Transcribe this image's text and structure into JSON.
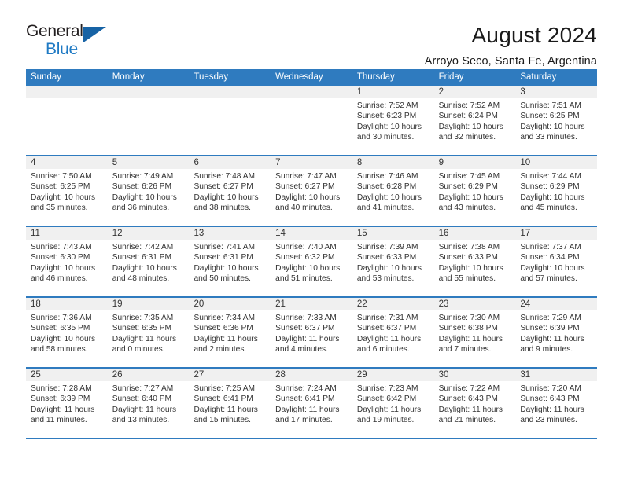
{
  "logo": {
    "text_primary": "General",
    "text_secondary": "Blue",
    "triangle_color": "#1763a5",
    "secondary_color": "#1f7ac4"
  },
  "header": {
    "title": "August 2024",
    "subtitle": "Arroyo Seco, Santa Fe, Argentina"
  },
  "theme": {
    "header_bar": "#2f7bbf",
    "date_band": "#f0f0f0",
    "text": "#333333"
  },
  "weekdays": [
    "Sunday",
    "Monday",
    "Tuesday",
    "Wednesday",
    "Thursday",
    "Friday",
    "Saturday"
  ],
  "weeks": [
    [
      {
        "day": "",
        "empty": true,
        "sunrise": "",
        "sunset": "",
        "daylight1": "",
        "daylight2": ""
      },
      {
        "day": "",
        "empty": true,
        "sunrise": "",
        "sunset": "",
        "daylight1": "",
        "daylight2": ""
      },
      {
        "day": "",
        "empty": true,
        "sunrise": "",
        "sunset": "",
        "daylight1": "",
        "daylight2": ""
      },
      {
        "day": "",
        "empty": true,
        "sunrise": "",
        "sunset": "",
        "daylight1": "",
        "daylight2": ""
      },
      {
        "day": "1",
        "empty": false,
        "sunrise": "Sunrise: 7:52 AM",
        "sunset": "Sunset: 6:23 PM",
        "daylight1": "Daylight: 10 hours",
        "daylight2": "and 30 minutes."
      },
      {
        "day": "2",
        "empty": false,
        "sunrise": "Sunrise: 7:52 AM",
        "sunset": "Sunset: 6:24 PM",
        "daylight1": "Daylight: 10 hours",
        "daylight2": "and 32 minutes."
      },
      {
        "day": "3",
        "empty": false,
        "sunrise": "Sunrise: 7:51 AM",
        "sunset": "Sunset: 6:25 PM",
        "daylight1": "Daylight: 10 hours",
        "daylight2": "and 33 minutes."
      }
    ],
    [
      {
        "day": "4",
        "empty": false,
        "sunrise": "Sunrise: 7:50 AM",
        "sunset": "Sunset: 6:25 PM",
        "daylight1": "Daylight: 10 hours",
        "daylight2": "and 35 minutes."
      },
      {
        "day": "5",
        "empty": false,
        "sunrise": "Sunrise: 7:49 AM",
        "sunset": "Sunset: 6:26 PM",
        "daylight1": "Daylight: 10 hours",
        "daylight2": "and 36 minutes."
      },
      {
        "day": "6",
        "empty": false,
        "sunrise": "Sunrise: 7:48 AM",
        "sunset": "Sunset: 6:27 PM",
        "daylight1": "Daylight: 10 hours",
        "daylight2": "and 38 minutes."
      },
      {
        "day": "7",
        "empty": false,
        "sunrise": "Sunrise: 7:47 AM",
        "sunset": "Sunset: 6:27 PM",
        "daylight1": "Daylight: 10 hours",
        "daylight2": "and 40 minutes."
      },
      {
        "day": "8",
        "empty": false,
        "sunrise": "Sunrise: 7:46 AM",
        "sunset": "Sunset: 6:28 PM",
        "daylight1": "Daylight: 10 hours",
        "daylight2": "and 41 minutes."
      },
      {
        "day": "9",
        "empty": false,
        "sunrise": "Sunrise: 7:45 AM",
        "sunset": "Sunset: 6:29 PM",
        "daylight1": "Daylight: 10 hours",
        "daylight2": "and 43 minutes."
      },
      {
        "day": "10",
        "empty": false,
        "sunrise": "Sunrise: 7:44 AM",
        "sunset": "Sunset: 6:29 PM",
        "daylight1": "Daylight: 10 hours",
        "daylight2": "and 45 minutes."
      }
    ],
    [
      {
        "day": "11",
        "empty": false,
        "sunrise": "Sunrise: 7:43 AM",
        "sunset": "Sunset: 6:30 PM",
        "daylight1": "Daylight: 10 hours",
        "daylight2": "and 46 minutes."
      },
      {
        "day": "12",
        "empty": false,
        "sunrise": "Sunrise: 7:42 AM",
        "sunset": "Sunset: 6:31 PM",
        "daylight1": "Daylight: 10 hours",
        "daylight2": "and 48 minutes."
      },
      {
        "day": "13",
        "empty": false,
        "sunrise": "Sunrise: 7:41 AM",
        "sunset": "Sunset: 6:31 PM",
        "daylight1": "Daylight: 10 hours",
        "daylight2": "and 50 minutes."
      },
      {
        "day": "14",
        "empty": false,
        "sunrise": "Sunrise: 7:40 AM",
        "sunset": "Sunset: 6:32 PM",
        "daylight1": "Daylight: 10 hours",
        "daylight2": "and 51 minutes."
      },
      {
        "day": "15",
        "empty": false,
        "sunrise": "Sunrise: 7:39 AM",
        "sunset": "Sunset: 6:33 PM",
        "daylight1": "Daylight: 10 hours",
        "daylight2": "and 53 minutes."
      },
      {
        "day": "16",
        "empty": false,
        "sunrise": "Sunrise: 7:38 AM",
        "sunset": "Sunset: 6:33 PM",
        "daylight1": "Daylight: 10 hours",
        "daylight2": "and 55 minutes."
      },
      {
        "day": "17",
        "empty": false,
        "sunrise": "Sunrise: 7:37 AM",
        "sunset": "Sunset: 6:34 PM",
        "daylight1": "Daylight: 10 hours",
        "daylight2": "and 57 minutes."
      }
    ],
    [
      {
        "day": "18",
        "empty": false,
        "sunrise": "Sunrise: 7:36 AM",
        "sunset": "Sunset: 6:35 PM",
        "daylight1": "Daylight: 10 hours",
        "daylight2": "and 58 minutes."
      },
      {
        "day": "19",
        "empty": false,
        "sunrise": "Sunrise: 7:35 AM",
        "sunset": "Sunset: 6:35 PM",
        "daylight1": "Daylight: 11 hours",
        "daylight2": "and 0 minutes."
      },
      {
        "day": "20",
        "empty": false,
        "sunrise": "Sunrise: 7:34 AM",
        "sunset": "Sunset: 6:36 PM",
        "daylight1": "Daylight: 11 hours",
        "daylight2": "and 2 minutes."
      },
      {
        "day": "21",
        "empty": false,
        "sunrise": "Sunrise: 7:33 AM",
        "sunset": "Sunset: 6:37 PM",
        "daylight1": "Daylight: 11 hours",
        "daylight2": "and 4 minutes."
      },
      {
        "day": "22",
        "empty": false,
        "sunrise": "Sunrise: 7:31 AM",
        "sunset": "Sunset: 6:37 PM",
        "daylight1": "Daylight: 11 hours",
        "daylight2": "and 6 minutes."
      },
      {
        "day": "23",
        "empty": false,
        "sunrise": "Sunrise: 7:30 AM",
        "sunset": "Sunset: 6:38 PM",
        "daylight1": "Daylight: 11 hours",
        "daylight2": "and 7 minutes."
      },
      {
        "day": "24",
        "empty": false,
        "sunrise": "Sunrise: 7:29 AM",
        "sunset": "Sunset: 6:39 PM",
        "daylight1": "Daylight: 11 hours",
        "daylight2": "and 9 minutes."
      }
    ],
    [
      {
        "day": "25",
        "empty": false,
        "sunrise": "Sunrise: 7:28 AM",
        "sunset": "Sunset: 6:39 PM",
        "daylight1": "Daylight: 11 hours",
        "daylight2": "and 11 minutes."
      },
      {
        "day": "26",
        "empty": false,
        "sunrise": "Sunrise: 7:27 AM",
        "sunset": "Sunset: 6:40 PM",
        "daylight1": "Daylight: 11 hours",
        "daylight2": "and 13 minutes."
      },
      {
        "day": "27",
        "empty": false,
        "sunrise": "Sunrise: 7:25 AM",
        "sunset": "Sunset: 6:41 PM",
        "daylight1": "Daylight: 11 hours",
        "daylight2": "and 15 minutes."
      },
      {
        "day": "28",
        "empty": false,
        "sunrise": "Sunrise: 7:24 AM",
        "sunset": "Sunset: 6:41 PM",
        "daylight1": "Daylight: 11 hours",
        "daylight2": "and 17 minutes."
      },
      {
        "day": "29",
        "empty": false,
        "sunrise": "Sunrise: 7:23 AM",
        "sunset": "Sunset: 6:42 PM",
        "daylight1": "Daylight: 11 hours",
        "daylight2": "and 19 minutes."
      },
      {
        "day": "30",
        "empty": false,
        "sunrise": "Sunrise: 7:22 AM",
        "sunset": "Sunset: 6:43 PM",
        "daylight1": "Daylight: 11 hours",
        "daylight2": "and 21 minutes."
      },
      {
        "day": "31",
        "empty": false,
        "sunrise": "Sunrise: 7:20 AM",
        "sunset": "Sunset: 6:43 PM",
        "daylight1": "Daylight: 11 hours",
        "daylight2": "and 23 minutes."
      }
    ]
  ]
}
